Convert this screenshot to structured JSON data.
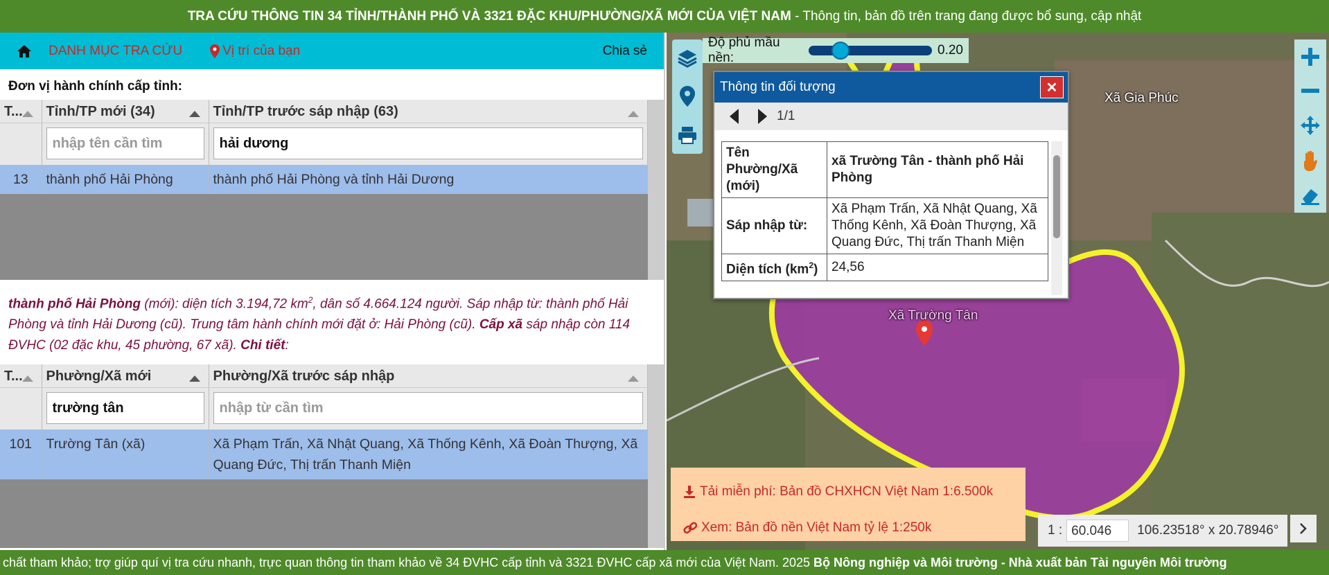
{
  "header": {
    "title_bold": "TRA CỨU THÔNG TIN 34 TỈNH/THÀNH PHỐ VÀ 3321 ĐẶC KHU/PHƯỜNG/XÃ MỚI CỦA VIỆT NAM",
    "title_rest": " - Thông tin, bản đồ trên trang đang được bổ sung, cập nhật"
  },
  "nav": {
    "menu_label": "DANH MỤC TRA CỨU",
    "location_label": "Vị trí của bạn",
    "share_label": "Chia sẻ"
  },
  "province_section": {
    "title": "Đơn vị hành chính cấp tỉnh:",
    "columns": [
      "T...",
      "Tỉnh/TP mới (34)",
      "Tỉnh/TP trước sáp nhập (63)"
    ],
    "filter_new_placeholder": "nhập tên cần tìm",
    "filter_old_value": "hải dương",
    "rows": [
      {
        "stt": "13",
        "new": "thành phố Hải Phòng",
        "old": "thành phố Hải Phòng và tỉnh Hải Dương"
      }
    ]
  },
  "summary": {
    "name": "thành phố Hải Phòng",
    "part1": " (mới): diện tích 3.194,72 km",
    "sup": "2",
    "part2": ", dân số 4.664.124 người. Sáp nhập từ: thành phố Hải Phòng và tỉnh Hải Dương (cũ). Trung tâm hành chính mới đặt ở: Hải Phòng (cũ). ",
    "cap_xa": "Cấp xã",
    "part3": " sáp nhập còn 114 ĐVHC (02 đặc khu, 45 phường, 67 xã). ",
    "detail": "Chi tiết",
    "colon": ":"
  },
  "commune_section": {
    "columns": [
      "T...",
      "Phường/Xã mới",
      "Phường/Xã trước sáp nhập"
    ],
    "filter_new_value": "trường tân",
    "filter_old_placeholder": "nhập từ cần tìm",
    "rows": [
      {
        "stt": "101",
        "new": "Trường Tân (xã)",
        "old": "Xã Phạm Trấn, Xã Nhật Quang, Xã Thống Kênh, Xã Đoàn Thượng, Xã Quang Đức, Thị trấn Thanh Miện"
      }
    ]
  },
  "map": {
    "opacity_label": "Độ phủ mầu nền:",
    "opacity_value": "0.20",
    "opacity_level": 0.2,
    "labels": {
      "gia_phuc": "Xã Gia Phúc",
      "truong_tan": "Xã Trường Tân"
    },
    "popup": {
      "title": "Thông tin đối tượng",
      "close": "✕",
      "pager": "1/1",
      "rows": [
        {
          "key": "Tên Phường/Xã (mới)",
          "value": "xã Trường Tân - thành phố Hải Phòng"
        },
        {
          "key": "Sáp nhập từ:",
          "value": "Xã Phạm Trấn, Xã Nhật Quang, Xã Thống Kênh, Xã Đoàn Thượng, Xã Quang Đức, Thị trấn Thanh Miện"
        },
        {
          "key_main": "Diện tích (km",
          "key_sup": "2",
          "key_end": ")",
          "value": "24,56"
        }
      ]
    },
    "download_label": "Tải miễn phí: Bản đồ CHXHCN Việt Nam 1:6.500k",
    "view_label": "Xem: Bản đồ nền Việt Nam tỷ lệ 1:250k",
    "scale_prefix": "1 :",
    "scale_value": "60.046",
    "coords": "106.23518° x 20.78946°"
  },
  "footer": {
    "text": "chất tham khảo; trợ giúp quí vị tra cứu nhanh, trực quan thông tin tham khảo về 34 ĐVHC cấp tỉnh và 3321 ĐVHC cấp xã mới của Việt Nam. 2025 ",
    "bold": "Bộ Nông nghiệp và Môi trường - Nhà xuất bản Tài nguyên Môi trường"
  },
  "colors": {
    "header_green": "#4e8a29",
    "nav_cyan": "#00bcd4",
    "selected_row": "#9dbdeb",
    "popup_blue": "#0f5a9e",
    "boundary": "#f4f22a",
    "area_fill": "#a03aa6"
  }
}
